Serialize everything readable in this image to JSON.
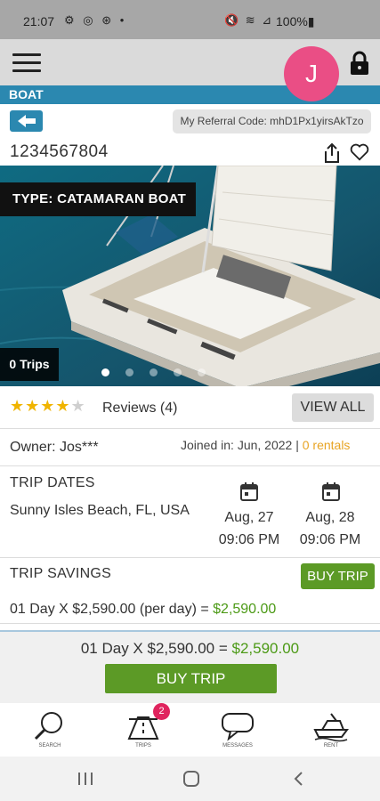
{
  "status_bar": {
    "time": "21:07",
    "left_icons": "⚙ ◎ ⊛ •",
    "right_icons": "🔇 ≋ ⊿",
    "battery": "100%▮"
  },
  "header": {
    "avatar_letter": "J"
  },
  "section": {
    "title": "BOAT"
  },
  "referral": {
    "text": "My Referral Code: mhD1Px1yirsAkTzo"
  },
  "boat": {
    "id": "1234567804",
    "type": "TYPE: CATAMARAN BOAT",
    "trips": "0 Trips"
  },
  "reviews": {
    "stars": "★★★★",
    "empty_star": "★",
    "rating": 4,
    "label": "Reviews (4)",
    "view_all": "VIEW ALL"
  },
  "owner": {
    "name": "Owner: Jos***",
    "joined": "Joined in: Jun, 2022 | ",
    "rentals": "0 rentals"
  },
  "trip_dates": {
    "label": "TRIP DATES",
    "location": "Sunny Isles Beach, FL, USA",
    "start_date": "Aug, 27",
    "start_time": "09:06 PM",
    "end_date": "Aug, 28",
    "end_time": "09:06 PM"
  },
  "savings": {
    "label": "TRIP SAVINGS",
    "buy_label": "BUY TRIP",
    "calc_prefix": "01 Day X $2,590.00 (per day) = ",
    "calc_total": "$2,590.00"
  },
  "footer": {
    "calc_prefix": "01 Day X $2,590.00 = ",
    "calc_total": "$2,590.00",
    "buy_label": "BUY TRIP"
  },
  "bottom_nav": {
    "items": [
      {
        "label": "SEARCH",
        "icon": "search-icon"
      },
      {
        "label": "TRIPS",
        "icon": "trips-icon",
        "badge": "2"
      },
      {
        "label": "MESSAGES",
        "icon": "messages-icon"
      },
      {
        "label": "RENT",
        "icon": "boat-icon"
      }
    ]
  },
  "colors": {
    "brand_blue": "#2b88b0",
    "accent_green": "#5c9a26",
    "avatar_pink": "#ea4e85",
    "rentals_orange": "#e8a423",
    "star_gold": "#f0b400"
  }
}
